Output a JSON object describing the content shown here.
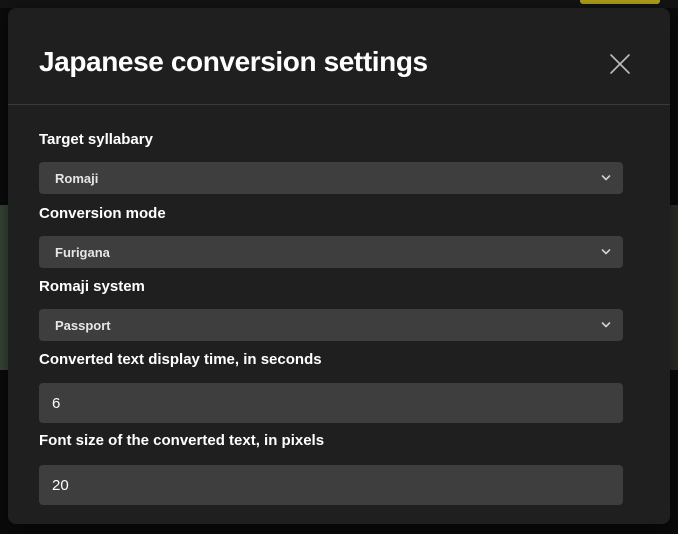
{
  "dialog": {
    "title": "Japanese conversion settings",
    "close_icon": "close-icon"
  },
  "fields": {
    "target_syllabary": {
      "label": "Target syllabary",
      "value": "Romaji"
    },
    "conversion_mode": {
      "label": "Conversion mode",
      "value": "Furigana"
    },
    "romaji_system": {
      "label": "Romaji system",
      "value": "Passport"
    },
    "display_time": {
      "label": "Converted text display time, in seconds",
      "value": "6"
    },
    "font_size": {
      "label": "Font size of the converted text, in pixels",
      "value": "20"
    }
  },
  "colors": {
    "modal_background": "#1f1f1f",
    "control_background": "#3e3e3e",
    "text": "#ffffff"
  }
}
